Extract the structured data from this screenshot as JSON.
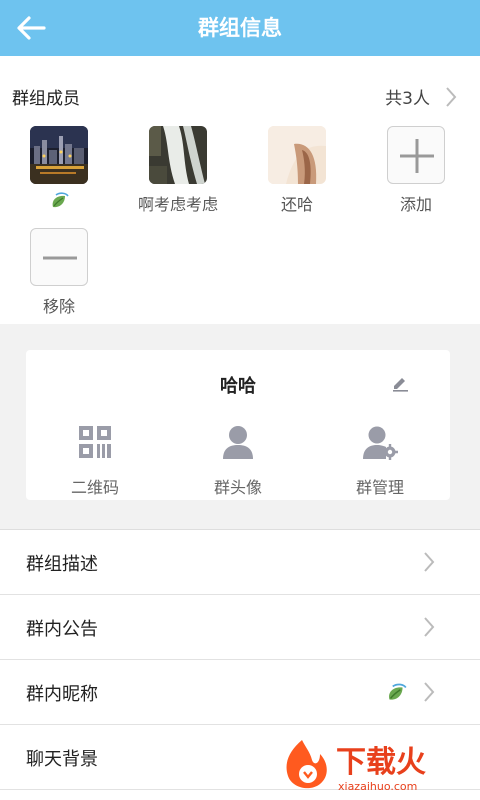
{
  "header": {
    "title": "群组信息",
    "back_icon": "arrow-left-icon"
  },
  "members": {
    "section_title": "群组成员",
    "count_label": "共3人",
    "items": [
      {
        "name": "",
        "avatar": "city-night-photo",
        "name_icon": "leaf-icon"
      },
      {
        "name": "啊考虑考虑",
        "avatar": "waterfall-photo"
      },
      {
        "name": "还哈",
        "avatar": "skin-photo"
      }
    ],
    "add_label": "添加",
    "remove_label": "移除"
  },
  "group_card": {
    "name": "哈哈",
    "actions": [
      {
        "label": "二维码",
        "icon": "qr-code-icon"
      },
      {
        "label": "群头像",
        "icon": "user-icon"
      },
      {
        "label": "群管理",
        "icon": "user-settings-icon"
      }
    ]
  },
  "settings": [
    {
      "label": "群组描述"
    },
    {
      "label": "群内公告"
    },
    {
      "label": "群内昵称",
      "value_icon": "leaf-icon"
    },
    {
      "label": "聊天背景"
    }
  ],
  "watermark": {
    "text": "下载火",
    "url_text": "xiazaihuo.com"
  },
  "colors": {
    "header": "#6ec3ef",
    "icon_gray": "#9a9ca8",
    "band": "#f2f2f2"
  }
}
